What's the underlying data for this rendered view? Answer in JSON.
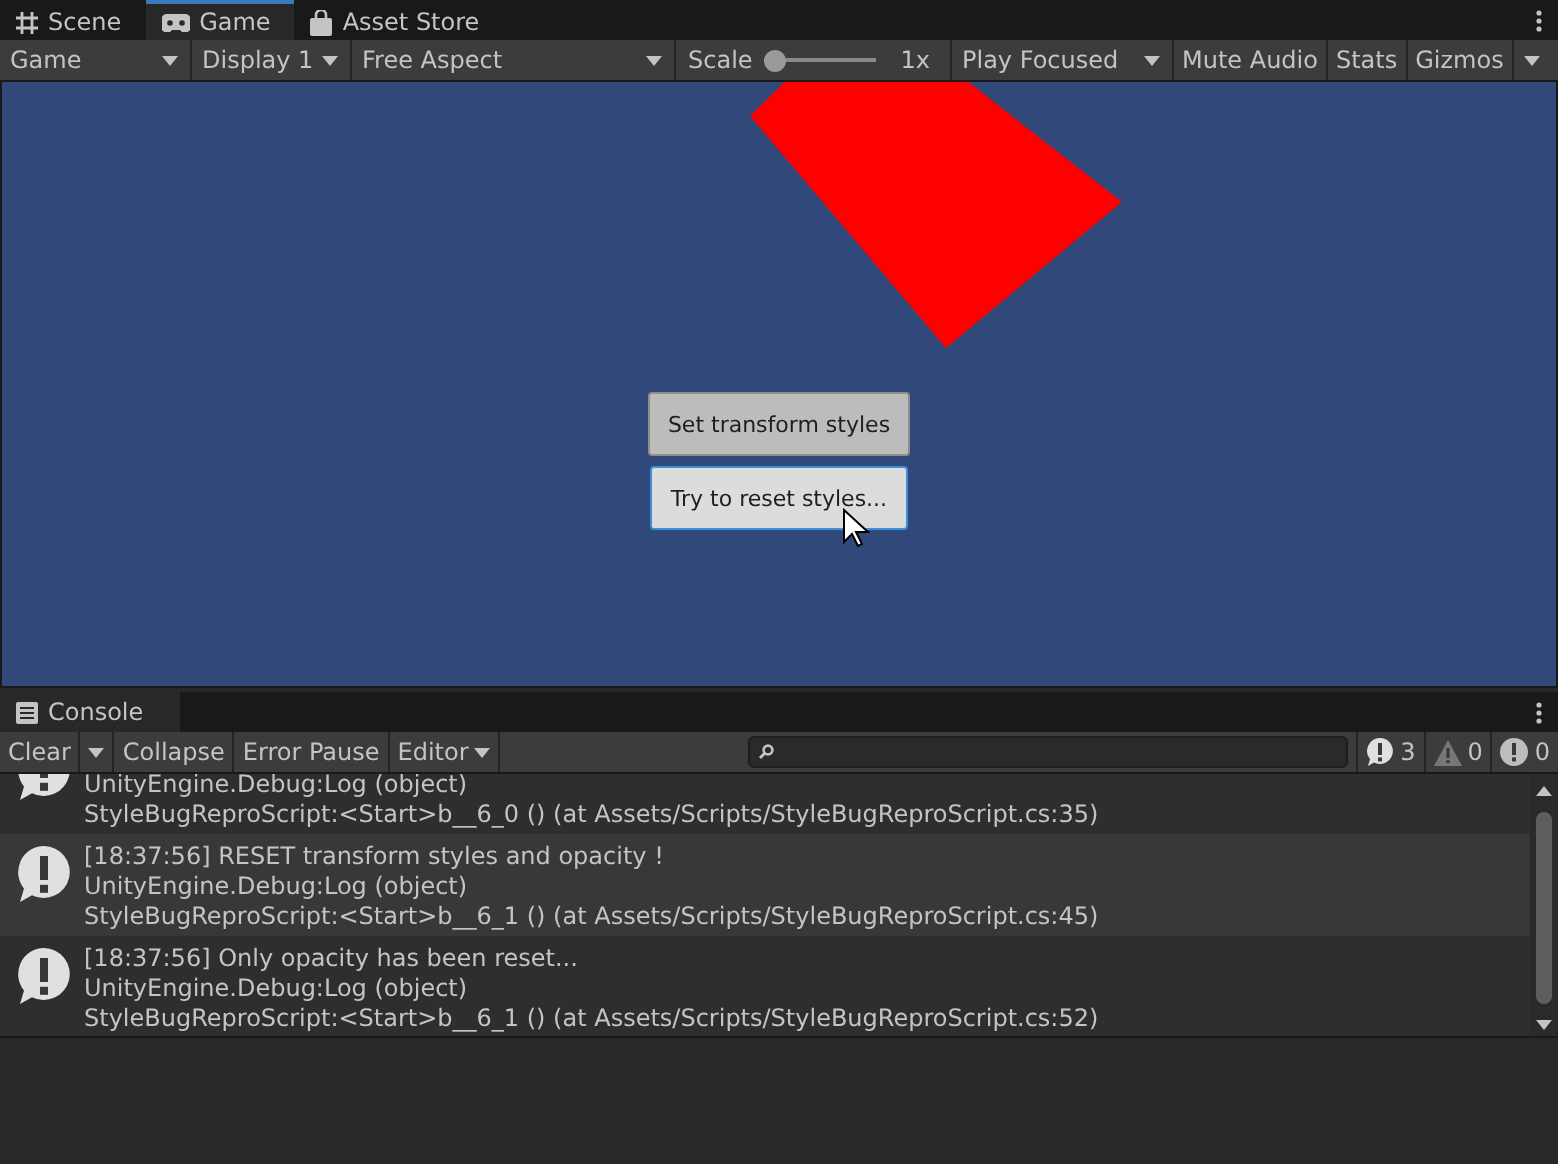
{
  "tabs": [
    {
      "label": "Scene",
      "selected": false
    },
    {
      "label": "Game",
      "selected": true
    },
    {
      "label": "Asset Store",
      "selected": false
    }
  ],
  "toolbar": {
    "view": "Game",
    "display": "Display 1",
    "aspect": "Free Aspect",
    "scale_label": "Scale",
    "scale": {
      "level": 0
    },
    "scale_value": "1x",
    "play_mode": "Play Focused",
    "mute": "Mute Audio",
    "stats": "Stats",
    "gizmos": "Gizmos"
  },
  "game_buttons": [
    {
      "label": "Set transform styles",
      "hovered": false
    },
    {
      "label": "Try to reset styles...",
      "hovered": true
    }
  ],
  "console": {
    "title": "Console",
    "toolbar": {
      "clear": "Clear",
      "collapse": "Collapse",
      "error_pause": "Error Pause",
      "editor": "Editor"
    },
    "counts": [
      {
        "kind": "info",
        "count": "3"
      },
      {
        "kind": "warning",
        "count": "0"
      },
      {
        "kind": "error",
        "count": "0"
      }
    ],
    "entries": [
      {
        "lines": [
          "UnityEngine.Debug:Log (object)",
          "StyleBugReproScript:<Start>b__6_0 () (at Assets/Scripts/StyleBugReproScript.cs:35)"
        ]
      },
      {
        "lines": [
          "[18:37:56] RESET transform styles and opacity !",
          "UnityEngine.Debug:Log (object)",
          "StyleBugReproScript:<Start>b__6_1 () (at Assets/Scripts/StyleBugReproScript.cs:45)"
        ]
      },
      {
        "lines": [
          "[18:37:56] Only opacity has been reset...",
          "UnityEngine.Debug:Log (object)",
          "StyleBugReproScript:<Start>b__6_1 () (at Assets/Scripts/StyleBugReproScript.cs:52)"
        ]
      }
    ]
  }
}
